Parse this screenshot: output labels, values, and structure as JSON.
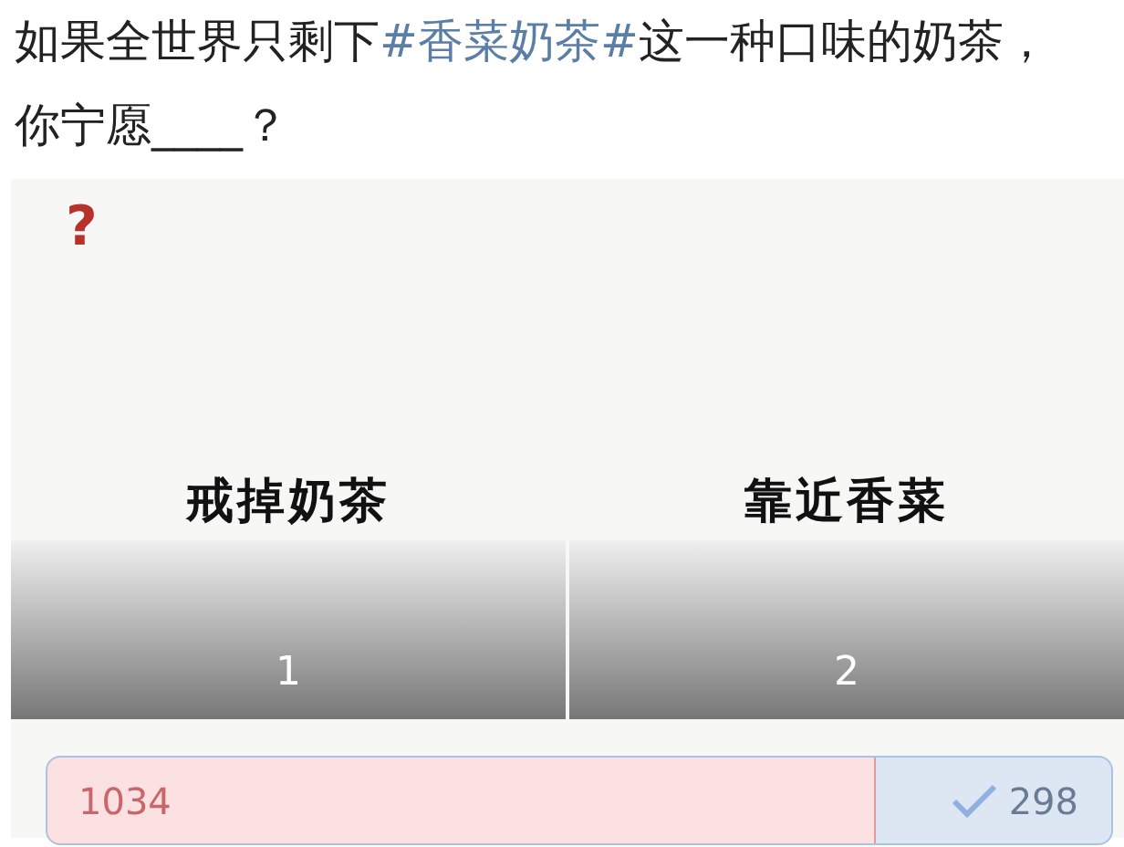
{
  "post": {
    "segments": [
      {
        "kind": "plain",
        "text": "如果全世界只剩下"
      },
      {
        "kind": "hashtag",
        "text": "#香菜奶茶#"
      },
      {
        "kind": "plain",
        "text": "这一种口味的奶茶，你宁愿____？"
      }
    ]
  },
  "poll": {
    "badge": "?",
    "options": [
      {
        "label": "戒掉奶茶",
        "number": "1"
      },
      {
        "label": "靠近香菜",
        "number": "2"
      }
    ],
    "level": 0.78,
    "results": [
      {
        "count": "1034",
        "selected": false
      },
      {
        "count": "298",
        "selected": true
      }
    ]
  }
}
